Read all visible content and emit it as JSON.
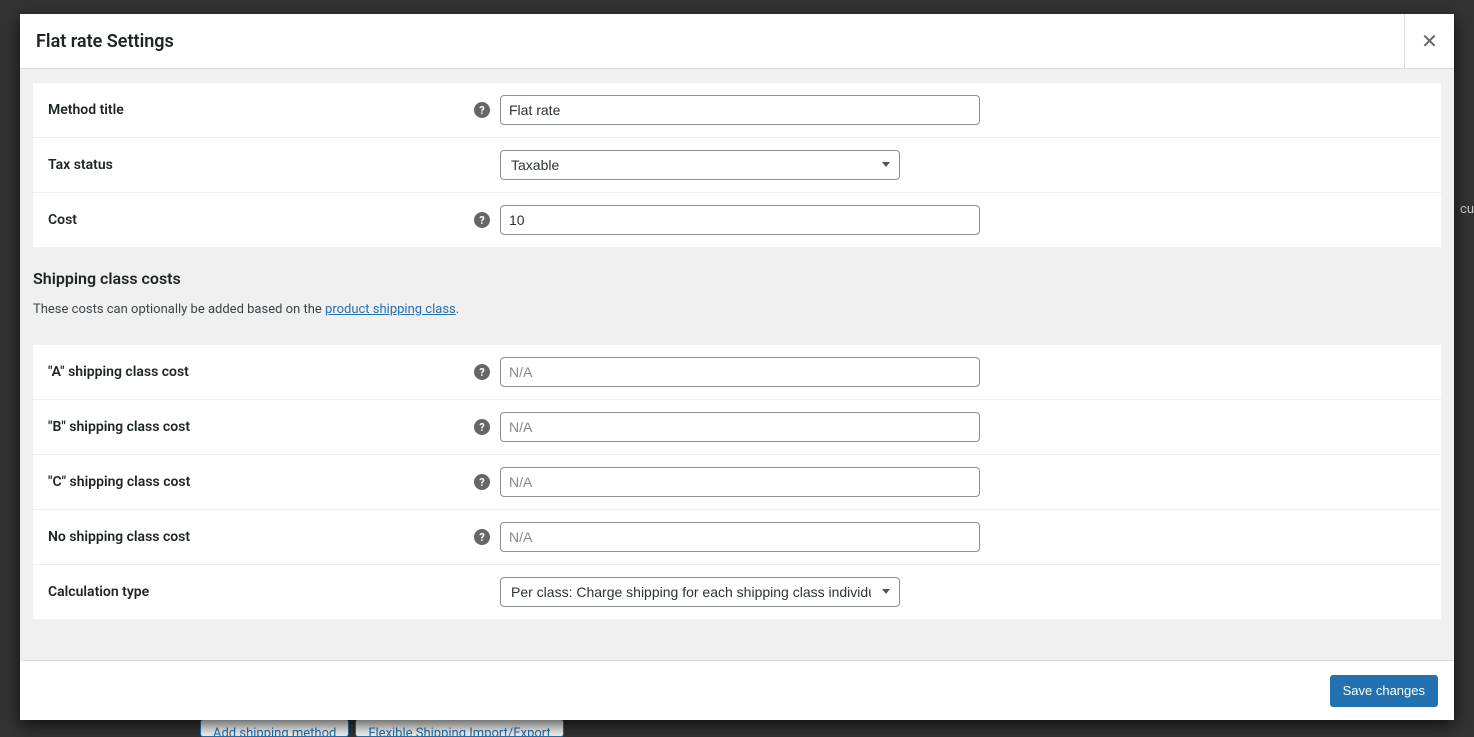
{
  "modal": {
    "title": "Flat rate Settings",
    "close_icon": "✕"
  },
  "fields": {
    "method_title": {
      "label": "Method title",
      "value": "Flat rate"
    },
    "tax_status": {
      "label": "Tax status",
      "selected": "Taxable"
    },
    "cost": {
      "label": "Cost",
      "value": "10"
    }
  },
  "shipping_class_section": {
    "title": "Shipping class costs",
    "desc_prefix": "These costs can optionally be added based on the ",
    "desc_link_text": "product shipping class",
    "desc_suffix": "."
  },
  "class_fields": {
    "a": {
      "label": "\"A\" shipping class cost",
      "placeholder": "N/A",
      "value": ""
    },
    "b": {
      "label": "\"B\" shipping class cost",
      "placeholder": "N/A",
      "value": ""
    },
    "c": {
      "label": "\"C\" shipping class cost",
      "placeholder": "N/A",
      "value": ""
    },
    "none": {
      "label": "No shipping class cost",
      "placeholder": "N/A",
      "value": ""
    },
    "calc_type": {
      "label": "Calculation type",
      "selected": "Per class: Charge shipping for each shipping class individually"
    }
  },
  "footer": {
    "save_label": "Save changes"
  },
  "background": {
    "add_method": "Add shipping method",
    "import_export": "Flexible Shipping Import/Export"
  },
  "partial_text": "cu"
}
